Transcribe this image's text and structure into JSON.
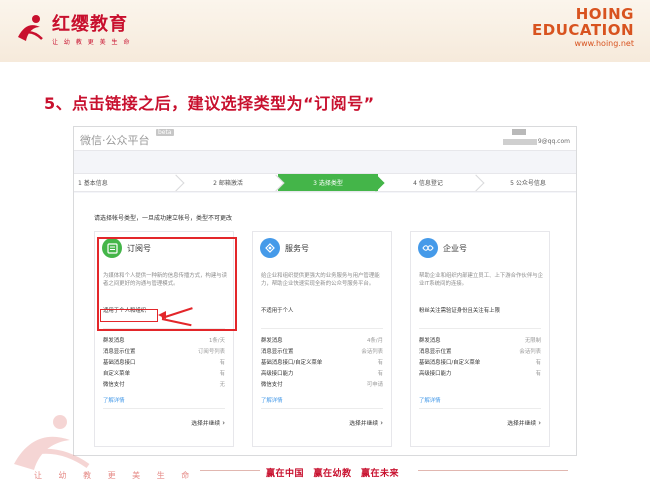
{
  "slide": {
    "brand_name": "红缨教育",
    "brand_slogan": "让 幼 教 更 美 生 命",
    "hoing_line1": "HOING",
    "hoing_line2": "EDUCATION",
    "hoing_url": "www.hoing.net",
    "title": "5、点击链接之后，建议选择类型为“订阅号”",
    "footer_slogan": "赢在中国　赢在幼教　赢在未来",
    "footer_left_slogan": "让 幼 教 更 美 生 命"
  },
  "platform": {
    "title": "微信·公众平台",
    "beta_badge": "beta",
    "account_email": "9@qq.com"
  },
  "steps": [
    {
      "label": "1 基本信息"
    },
    {
      "label": "2 邮箱激活"
    },
    {
      "label": "3 选择类型"
    },
    {
      "label": "4 信息登记"
    },
    {
      "label": "5 公众号信息"
    }
  ],
  "instruction": "请选择帐号类型，一旦成功建立帐号，类型不可更改",
  "cards": [
    {
      "title": "订阅号",
      "icon": "subscription-icon",
      "color": "#44b549",
      "desc": "为媒体和个人提供一种新的信息传播方式，构建与读者之间更好的沟通与管理模式。",
      "note": "适用于个人和组织",
      "features": [
        {
          "name": "群发消息",
          "value": "1条/天"
        },
        {
          "name": "消息显示位置",
          "value": "订阅号列表"
        },
        {
          "name": "基础消息接口",
          "value": "有"
        },
        {
          "name": "自定义菜单",
          "value": "有"
        },
        {
          "name": "微信支付",
          "value": "无"
        }
      ],
      "learn_more": "了解详情",
      "select": "选择并继续"
    },
    {
      "title": "服务号",
      "icon": "service-icon",
      "color": "#459ae9",
      "desc": "给企业和组织提供更强大的业务服务与用户管理能力，帮助企业快速实现全新的公众号服务平台。",
      "note": "不适用于个人",
      "features": [
        {
          "name": "群发消息",
          "value": "4条/月"
        },
        {
          "name": "消息显示位置",
          "value": "会话列表"
        },
        {
          "name": "基础消息接口/自定义菜单",
          "value": "有"
        },
        {
          "name": "高级接口能力",
          "value": "有"
        },
        {
          "name": "微信支付",
          "value": "可申请"
        }
      ],
      "learn_more": "了解详情",
      "select": "选择并继续"
    },
    {
      "title": "企业号",
      "icon": "enterprise-icon",
      "color": "#459ae9",
      "desc": "帮助企业和组织内部建立员工、上下游合作伙伴与企业IT系统间的连接。",
      "note": "粉丝关注需验证身份且关注有上限",
      "features": [
        {
          "name": "群发消息",
          "value": "无限制"
        },
        {
          "name": "消息显示位置",
          "value": "会话列表"
        },
        {
          "name": "基础消息接口/自定义菜单",
          "value": "有"
        },
        {
          "name": "高级接口能力",
          "value": "有"
        }
      ],
      "learn_more": "了解详情",
      "select": "选择并继续"
    }
  ],
  "colors": {
    "brand_red": "#c8102e",
    "wechat_green": "#44b549",
    "link_blue": "#459ae9",
    "highlight_red": "#e3262a"
  }
}
